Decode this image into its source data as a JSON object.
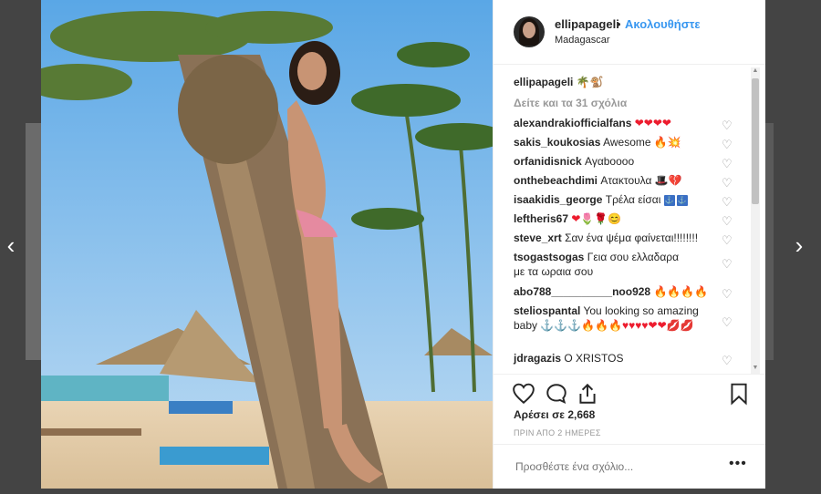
{
  "post": {
    "username": "ellipapageli",
    "dot": "•",
    "follow_label": "Ακολουθήστε",
    "location": "Madagascar",
    "caption_user": "ellipapageli",
    "caption_text": "🌴🐒",
    "view_all": "Δείτε και τα 31 σχόλια",
    "likes": "Αρέσει σε 2,668",
    "time": "ΠΡΙΝ ΑΠΟ 2 ΗΜΕΡΕΣ",
    "add_comment_placeholder": "Προσθέστε ένα σχόλιο...",
    "more": "•••"
  },
  "comments": [
    {
      "user": "alexandrakiofficialfans",
      "text": "",
      "emoji": "❤❤❤❤",
      "emoji_kind": "red"
    },
    {
      "user": "sakis_koukosias",
      "text": "Awesome",
      "emoji": "🔥💥",
      "emoji_kind": "fire"
    },
    {
      "user": "orfanidisnick",
      "text": "Αγαbοοοο",
      "emoji": "",
      "emoji_kind": ""
    },
    {
      "user": "onthebeachdimi",
      "text": "Ατακτουλα",
      "emoji": "🎩💔",
      "emoji_kind": "red"
    },
    {
      "user": "isaakidis_george",
      "text": "Τρέλα είσαι",
      "emoji": "⚓⚓",
      "emoji_kind": "blue"
    },
    {
      "user": "leftheris67",
      "text": "",
      "emoji": "❤🌷🌹😊",
      "emoji_kind": "red"
    },
    {
      "user": "steve_xrt",
      "text": "Σαν ένα ψέμα φαίνεται!!!!!!!!",
      "emoji": "",
      "emoji_kind": ""
    },
    {
      "user": "tsogastsogas",
      "text": "Γεια σου ελλαδαρα με τα ωραια σου",
      "emoji": "",
      "emoji_kind": ""
    },
    {
      "user": "abo788__________noo928",
      "text": "",
      "emoji": "🔥🔥🔥🔥",
      "emoji_kind": "fire"
    },
    {
      "user": "steliospantal",
      "text": "You looking so amazing baby",
      "emoji": "⚓⚓⚓🔥🔥🔥♥♥♥♥❤❤💋💋",
      "emoji_kind": "mixed"
    },
    {
      "user": "jdragazis",
      "text": "Ο XRISTOS",
      "emoji": "",
      "emoji_kind": ""
    }
  ],
  "icons": {
    "prev": "chevron-left-icon",
    "next": "chevron-right-icon",
    "like": "heart-icon",
    "comment": "comment-icon",
    "share": "share-icon",
    "save": "bookmark-icon"
  },
  "colors": {
    "accent": "#3897f0",
    "text": "#262626",
    "muted": "#999999",
    "heart_red": "#ed1c2e"
  }
}
